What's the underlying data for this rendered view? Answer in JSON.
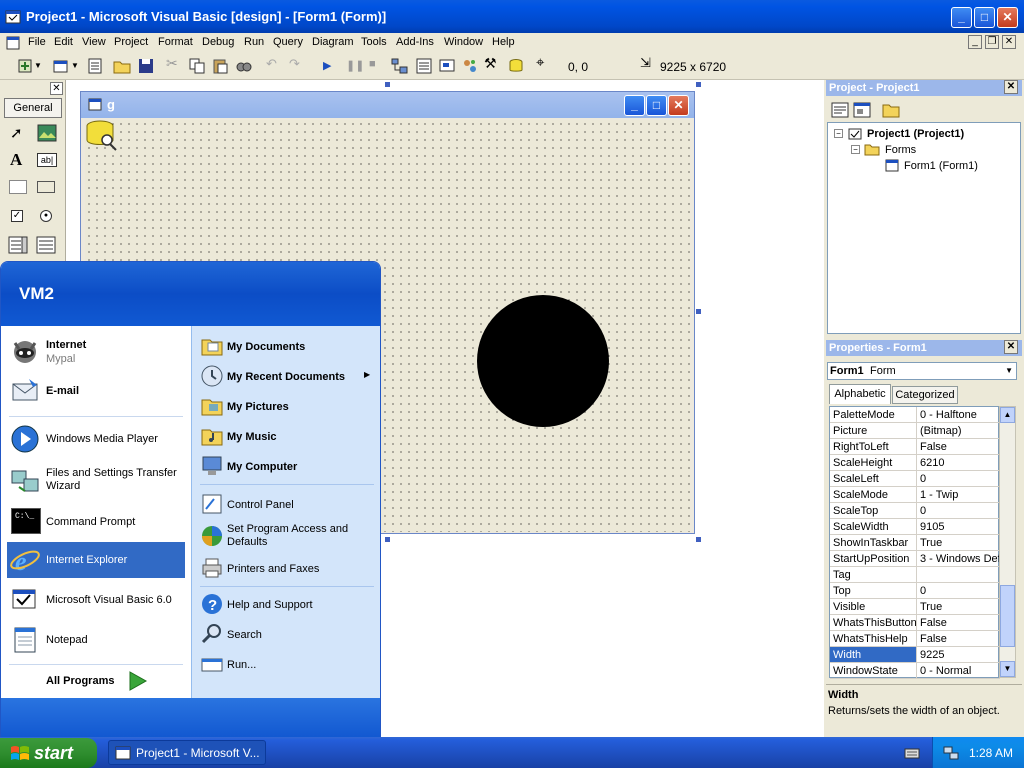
{
  "window": {
    "title": "Project1 - Microsoft Visual Basic [design] - [Form1 (Form)]"
  },
  "menu": [
    "File",
    "Edit",
    "View",
    "Project",
    "Format",
    "Debug",
    "Run",
    "Query",
    "Diagram",
    "Tools",
    "Add-Ins",
    "Window",
    "Help"
  ],
  "toolbar": {
    "position": "0, 0",
    "size": "9225 x 6720"
  },
  "toolbox": {
    "tab": "General"
  },
  "form": {
    "title": "g"
  },
  "project_panel": {
    "title": "Project - Project1",
    "root": "Project1 (Project1)",
    "folder": "Forms",
    "form_item": "Form1 (Form1)"
  },
  "properties_panel": {
    "title": "Properties - Form1",
    "object_name": "Form1",
    "object_type": "Form",
    "tabs": [
      "Alphabetic",
      "Categorized"
    ],
    "rows": [
      {
        "name": "PaletteMode",
        "value": "0 - Halftone"
      },
      {
        "name": "Picture",
        "value": "(Bitmap)"
      },
      {
        "name": "RightToLeft",
        "value": "False"
      },
      {
        "name": "ScaleHeight",
        "value": "6210"
      },
      {
        "name": "ScaleLeft",
        "value": "0"
      },
      {
        "name": "ScaleMode",
        "value": "1 - Twip"
      },
      {
        "name": "ScaleTop",
        "value": "0"
      },
      {
        "name": "ScaleWidth",
        "value": "9105"
      },
      {
        "name": "ShowInTaskbar",
        "value": "True"
      },
      {
        "name": "StartUpPosition",
        "value": "3 - Windows Def"
      },
      {
        "name": "Tag",
        "value": ""
      },
      {
        "name": "Top",
        "value": "0"
      },
      {
        "name": "Visible",
        "value": "True"
      },
      {
        "name": "WhatsThisButton",
        "value": "False"
      },
      {
        "name": "WhatsThisHelp",
        "value": "False"
      },
      {
        "name": "Width",
        "value": "9225"
      },
      {
        "name": "WindowState",
        "value": "0 - Normal"
      }
    ],
    "selected": "Width",
    "desc_title": "Width",
    "desc_text": "Returns/sets the width of an object."
  },
  "start_menu": {
    "user": "VM2",
    "pinned": [
      {
        "label": "Internet",
        "sub": "Mypal"
      },
      {
        "label": "E-mail",
        "sub": ""
      }
    ],
    "recent": [
      "Windows Media Player",
      "Files and Settings Transfer Wizard",
      "Command Prompt",
      "Internet Explorer",
      "Microsoft Visual Basic 6.0",
      "Notepad"
    ],
    "all_programs": "All Programs",
    "right_bold": [
      "My Documents",
      "My Recent Documents",
      "My Pictures",
      "My Music",
      "My Computer"
    ],
    "right_mid": [
      "Control Panel",
      "Set Program Access and Defaults",
      "Printers and Faxes"
    ],
    "right_low": [
      "Help and Support",
      "Search",
      "Run..."
    ]
  },
  "taskbar": {
    "start": "start",
    "task": "Project1 - Microsoft V...",
    "clock": "1:28 AM"
  },
  "colors": {
    "xp_blue": "#0054e3",
    "start_green": "#2f8e2f",
    "highlight": "#316ac5"
  }
}
